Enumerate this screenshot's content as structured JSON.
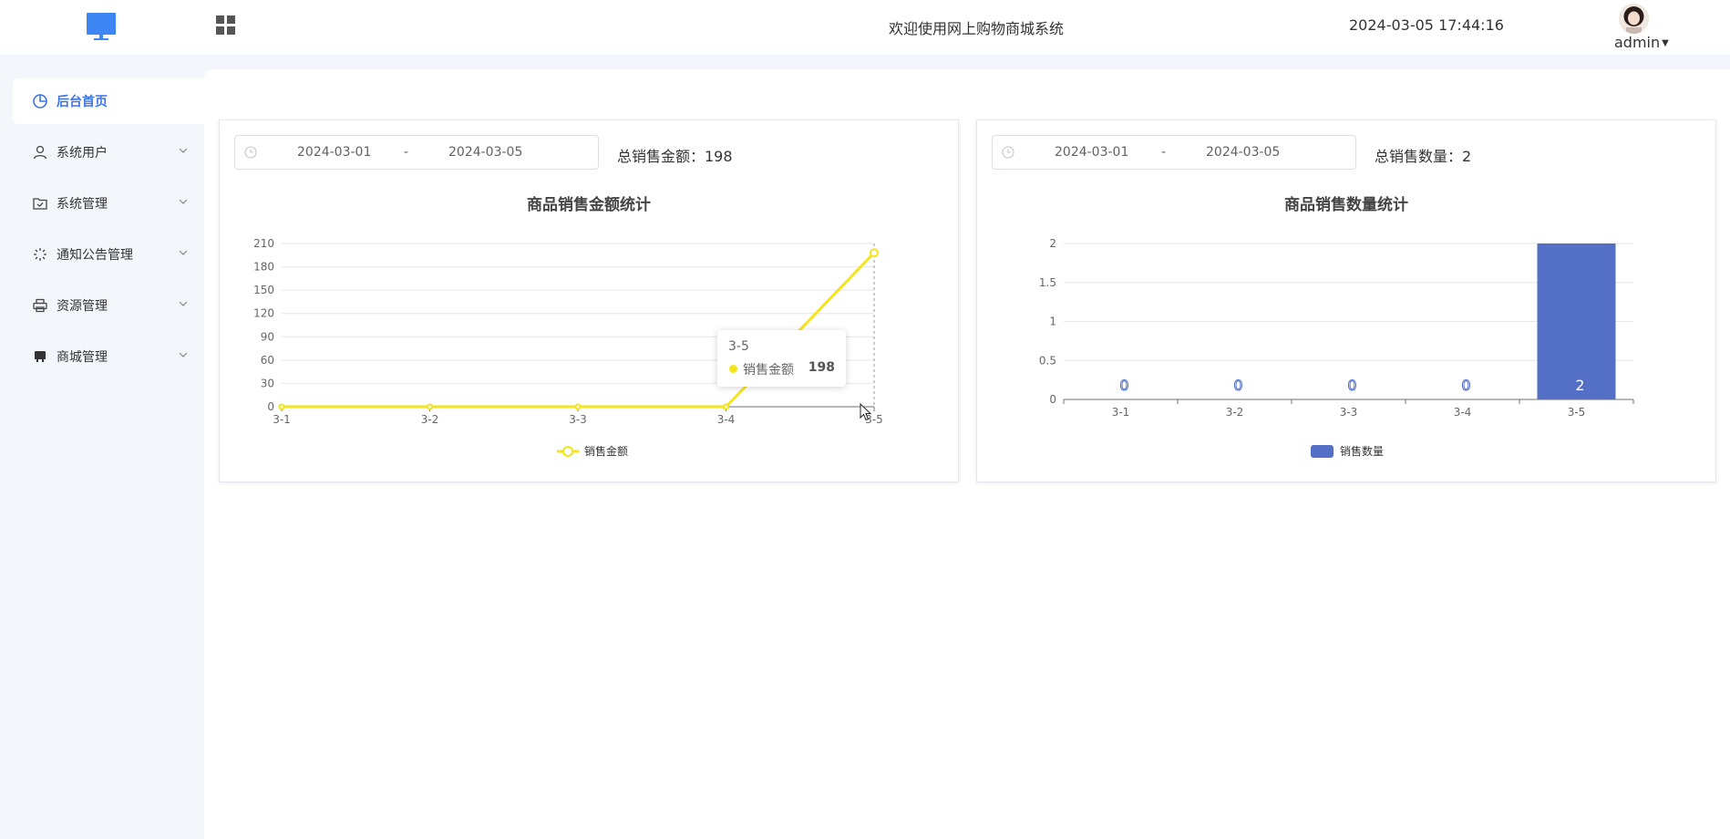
{
  "header": {
    "welcome": "欢迎使用网上购物商城系统",
    "datetime": "2024-03-05 17:44:16",
    "user": "admin",
    "icons": [
      "monitor-logo-icon",
      "grid-menu-icon",
      "avatar"
    ]
  },
  "sidebar": {
    "items": [
      {
        "label": "后台首页",
        "icon": "pie-chart-icon",
        "active": true
      },
      {
        "label": "系统用户",
        "icon": "user-icon"
      },
      {
        "label": "系统管理",
        "icon": "folder-check-icon"
      },
      {
        "label": "通知公告管理",
        "icon": "sparkle-icon"
      },
      {
        "label": "资源管理",
        "icon": "printer-icon"
      },
      {
        "label": "商城管理",
        "icon": "store-icon"
      }
    ]
  },
  "colors": {
    "accent": "#3d74e6",
    "line": "#f5e41a",
    "bar": "#5470c6"
  },
  "sales_amount": {
    "start_date": "2024-03-01",
    "separator": "-",
    "end_date": "2024-03-05",
    "total_label": "总销售金额：198",
    "chart_title": "商品销售金额统计",
    "tooltip": {
      "title": "3-5",
      "name": "销售金额",
      "value": "198"
    }
  },
  "sales_count": {
    "start_date": "2024-03-01",
    "separator": "-",
    "end_date": "2024-03-05",
    "total_label": "总销售数量：2",
    "chart_title": "商品销售数量统计"
  },
  "chart_data": [
    {
      "type": "line",
      "title": "商品销售金额统计",
      "categories": [
        "3-1",
        "3-2",
        "3-3",
        "3-4",
        "3-5"
      ],
      "series": [
        {
          "name": "销售金额",
          "values": [
            0,
            0,
            0,
            0,
            198
          ]
        }
      ],
      "yticks": [
        0,
        30,
        60,
        90,
        120,
        150,
        180,
        210
      ],
      "ylim": [
        0,
        210
      ],
      "grid": true,
      "legend": "bottom-center"
    },
    {
      "type": "bar",
      "title": "商品销售数量统计",
      "categories": [
        "3-1",
        "3-2",
        "3-3",
        "3-4",
        "3-5"
      ],
      "series": [
        {
          "name": "销售数量",
          "values": [
            0,
            0,
            0,
            0,
            2
          ]
        }
      ],
      "data_labels": [
        "0",
        "0",
        "0",
        "0",
        "2"
      ],
      "yticks": [
        "0",
        "0.5",
        "1",
        "1.5",
        "2"
      ],
      "ylim": [
        0,
        2
      ],
      "grid": true,
      "legend": "bottom-center"
    }
  ]
}
